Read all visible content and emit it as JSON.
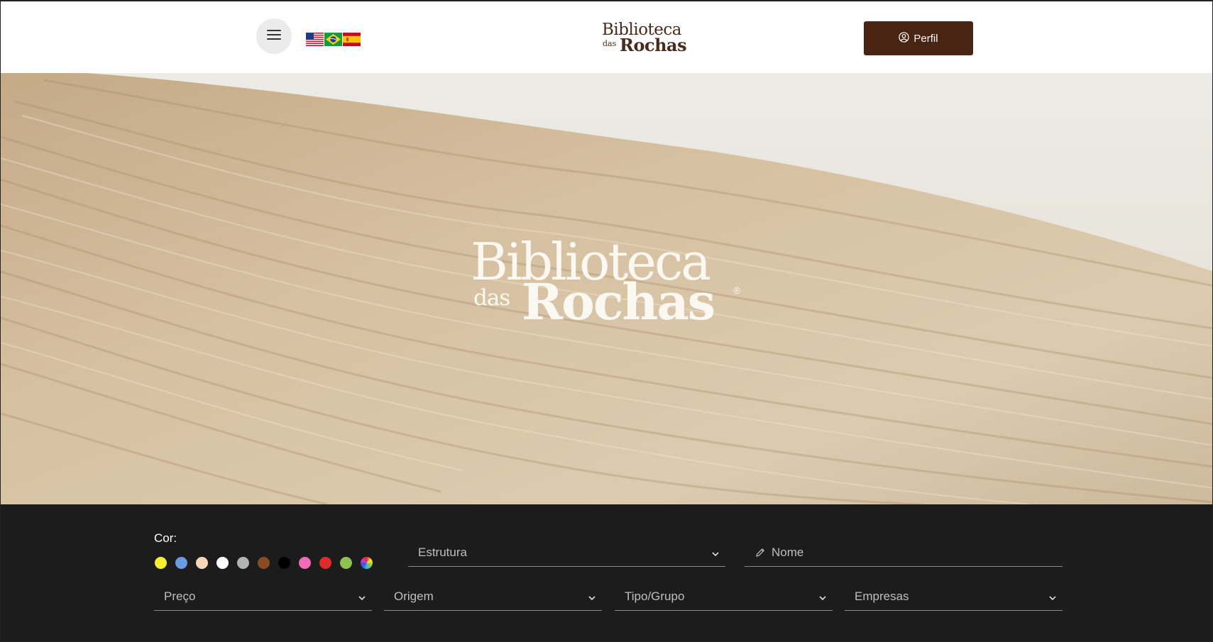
{
  "header": {
    "menu_icon": "hamburger-icon",
    "flags": [
      {
        "name": "us-flag-icon",
        "lang": "en"
      },
      {
        "name": "br-flag-icon",
        "lang": "pt"
      },
      {
        "name": "es-flag-icon",
        "lang": "es"
      }
    ],
    "logo": {
      "line1": "Biblioteca",
      "line2": "das",
      "line3": "Rochas"
    },
    "perfil_label": "Perfil",
    "perfil_icon": "user-circle-icon",
    "brand_color": "#4a2412"
  },
  "hero": {
    "logo": {
      "line1": "Biblioteca",
      "line2": "das",
      "line3": "Rochas",
      "mark": "®"
    }
  },
  "filters": {
    "color_label": "Cor:",
    "colors": [
      "#f4ef2e",
      "#6a9be0",
      "#f5d7b8",
      "#ffffff",
      "#b3b3b3",
      "#8a4b22",
      "#000000",
      "#f06cb8",
      "#e02b2b",
      "#8fc34f",
      "multicolor"
    ],
    "estrutura": "Estrutura",
    "nome_placeholder": "Nome",
    "preco": "Preço",
    "origem": "Origem",
    "tipo_grupo": "Tipo/Grupo",
    "empresas": "Empresas"
  }
}
